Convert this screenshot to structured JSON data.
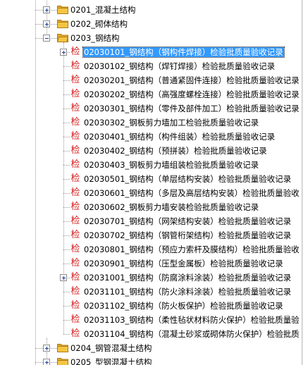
{
  "tree": {
    "folders": [
      {
        "label": "0201_混凝土结构",
        "icon": "folder-closed-icon",
        "expanded": false
      },
      {
        "label": "0202_砌体结构",
        "icon": "folder-closed-icon",
        "expanded": false
      },
      {
        "label": "0203_钢结构",
        "icon": "folder-open-icon",
        "expanded": true
      }
    ],
    "records_icon_glyph": "检",
    "records": [
      {
        "label": "02030101_钢结构（钢构件焊接）检验批质量验收记录",
        "selected": true,
        "expandable": true
      },
      {
        "label": "02030102_钢结构（焊钉焊接）检验批质量验收记录"
      },
      {
        "label": "02030201_钢结构（普通紧固件连接）检验批质量验收记录"
      },
      {
        "label": "02030202_钢结构（高强度螺栓连接）检验批质量验收记录"
      },
      {
        "label": "02030301_钢结构（零件及部件加工）检验批质量验收记录"
      },
      {
        "label": "02030302_钢板剪力墙加工检验批质量验收记录"
      },
      {
        "label": "02030401_钢结构（构件组装）检验批质量验收记录"
      },
      {
        "label": "02030402_钢结构（预拼装）检验批质量验收记录"
      },
      {
        "label": "02030403_钢板剪力墙组装检验批质量验收记录"
      },
      {
        "label": "02030501_钢结构（单层结构安装）检验批质量验收记录"
      },
      {
        "label": "02030601_钢结构（多层及高层结构安装）检验批质量验收"
      },
      {
        "label": "02030602_钢板剪力墙安装检验批质量验收记录"
      },
      {
        "label": "02030701_钢结构（网架结构安装）检验批质量验收记录"
      },
      {
        "label": "02030702_钢结构（钢管桁架结构）检验批质量验收记录"
      },
      {
        "label": "02030801_钢结构（预应力索杆及膜结构）检验批质量验收"
      },
      {
        "label": "02030901_钢结构（压型金属板）检验批质量验收记录"
      },
      {
        "label": "02031001_钢结构（防腐涂料涂装）检验批质量验收记录",
        "expandable": true
      },
      {
        "label": "02031101_钢结构（防火涂料涂装）检验批质量验收记录"
      },
      {
        "label": "02031102_钢结构（防火板保护）检验批质量验收记录"
      },
      {
        "label": "02031103_钢结构（柔性毡状材料防火保护）检验批质量验"
      },
      {
        "label": "02031104_钢结构（混凝土砂浆或砌体防火保护）检验批质"
      }
    ],
    "folders_after": [
      {
        "label": "0204_钢管混凝土结构",
        "icon": "folder-closed-icon",
        "expanded": false
      },
      {
        "label": "0205_型钢混凝土结构",
        "icon": "folder-closed-icon",
        "expanded": false
      }
    ]
  },
  "colors": {
    "selection": "#3399ff",
    "record_icon": "#d41b1b",
    "folder": "#f4c542"
  }
}
